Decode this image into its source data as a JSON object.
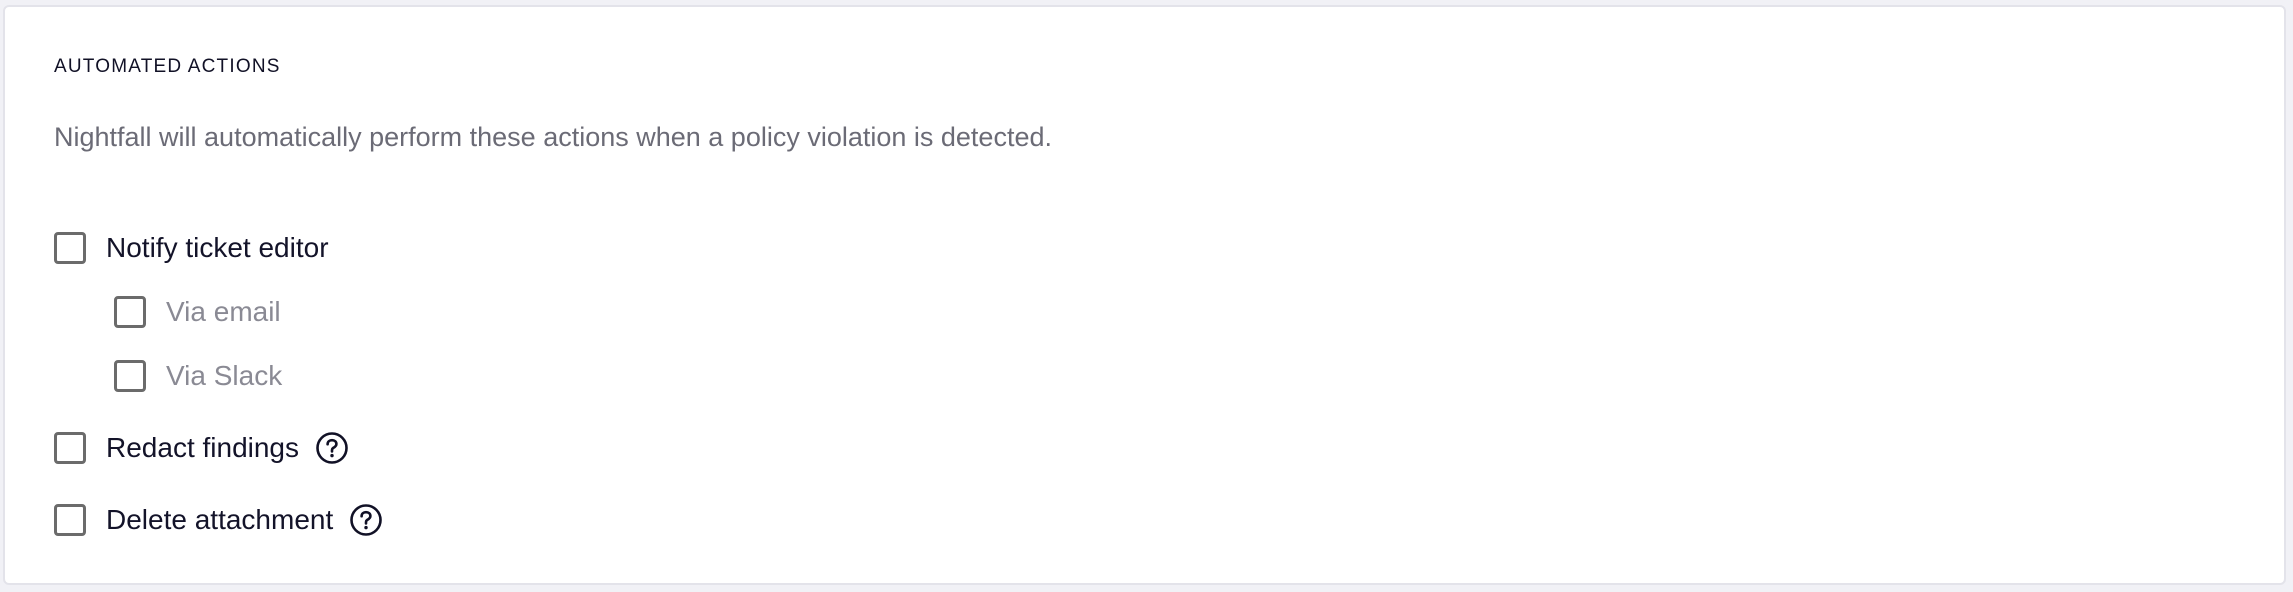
{
  "section": {
    "title": "AUTOMATED ACTIONS",
    "description": "Nightfall will automatically perform these actions when a policy violation is detected."
  },
  "options": {
    "notify_editor": {
      "label": "Notify ticket editor",
      "checked": false
    },
    "via_email": {
      "label": "Via email",
      "checked": false
    },
    "via_slack": {
      "label": "Via Slack",
      "checked": false
    },
    "redact_findings": {
      "label": "Redact findings",
      "checked": false,
      "icon": "help-circle-icon"
    },
    "delete_attachment": {
      "label": "Delete attachment",
      "checked": false,
      "icon": "help-circle-icon"
    }
  },
  "colors": {
    "text_primary": "#131329",
    "text_muted": "#8a8a94",
    "checkbox_border": "#6b6b6b",
    "card_border": "#e3e3ea"
  }
}
